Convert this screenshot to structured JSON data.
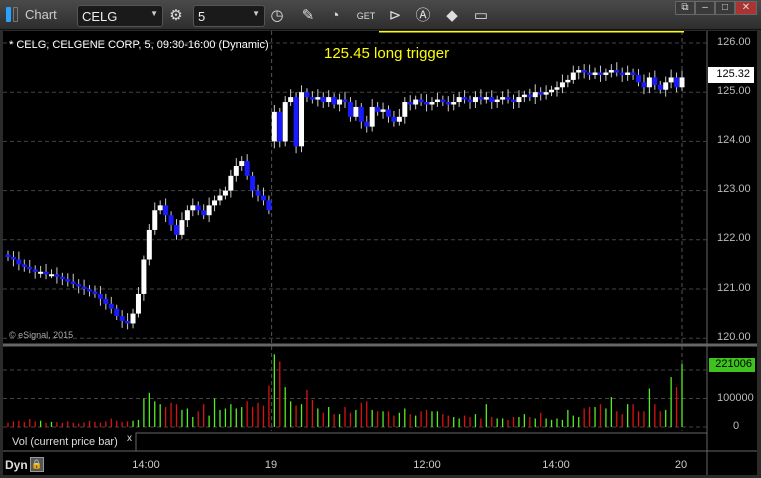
{
  "window": {
    "title": "Chart",
    "symbol": "CELG",
    "interval": "5"
  },
  "toolbar": {
    "icons": [
      "settings-icon",
      "clock-icon",
      "pencil-icon",
      "study-icon",
      "get-icon",
      "play-icon",
      "alert-icon",
      "eraser-icon",
      "comment-icon"
    ]
  },
  "chart": {
    "header": "* CELG, CELGENE CORP, 5, 09:30-16:00 (Dynamic)",
    "annotation": "125.45 long trigger",
    "trigger_price": 125.32,
    "copyright": "© eSignal, 2015",
    "last_price": "125.32",
    "last_volume": "221006",
    "price_labels": [
      "126.00",
      "125.00",
      "124.00",
      "123.00",
      "122.00",
      "121.00",
      "120.00"
    ],
    "volume_labels": [
      "100000",
      "0"
    ],
    "time_labels": [
      "14:00",
      "19",
      "12:00",
      "14:00",
      "20"
    ],
    "volume_study": "Vol (current price bar)",
    "volume_close": "x",
    "dyn_label": "Dyn",
    "colors": {
      "up": "#ffffff",
      "down": "#1a1aff",
      "vol_up": "#55ee22",
      "vol_down": "#dd1111",
      "trigger": "#ffff00"
    }
  },
  "chart_data": {
    "type": "candlestick",
    "ylim": [
      120,
      126.2
    ],
    "closes": [
      121.65,
      121.6,
      121.5,
      121.45,
      121.4,
      121.35,
      121.35,
      121.3,
      121.3,
      121.25,
      121.2,
      121.15,
      121.1,
      121.05,
      121.0,
      120.95,
      120.9,
      120.8,
      120.7,
      120.6,
      120.45,
      120.35,
      120.3,
      120.5,
      120.9,
      121.6,
      122.2,
      122.6,
      122.7,
      122.5,
      122.3,
      122.1,
      122.4,
      122.6,
      122.7,
      122.6,
      122.5,
      122.7,
      122.8,
      122.9,
      123.0,
      123.3,
      123.5,
      123.6,
      123.3,
      123.0,
      122.9,
      122.8,
      122.6,
      124.6,
      124.0,
      124.8,
      124.9,
      123.9,
      125.0,
      124.9,
      124.85,
      124.9,
      124.8,
      124.9,
      124.75,
      124.85,
      124.8,
      124.5,
      124.7,
      124.4,
      124.3,
      124.7,
      124.6,
      124.65,
      124.5,
      124.4,
      124.5,
      124.8,
      124.75,
      124.85,
      124.8,
      124.75,
      124.8,
      124.85,
      124.8,
      124.75,
      124.8,
      124.9,
      124.85,
      124.8,
      124.9,
      124.85,
      124.9,
      124.8,
      124.85,
      124.9,
      124.85,
      124.8,
      124.9,
      124.95,
      124.9,
      125.0,
      124.95,
      125.0,
      125.05,
      125.1,
      125.2,
      125.25,
      125.4,
      125.45,
      125.4,
      125.35,
      125.4,
      125.35,
      125.4,
      125.45,
      125.4,
      125.35,
      125.4,
      125.35,
      125.2,
      125.1,
      125.3,
      125.15,
      125.05,
      125.2,
      125.3,
      125.1,
      125.3
    ],
    "volumes": [
      15,
      20,
      22,
      18,
      28,
      20,
      22,
      15,
      18,
      17,
      14,
      20,
      15,
      12,
      16,
      22,
      18,
      15,
      20,
      30,
      22,
      18,
      20,
      22,
      25,
      100,
      120,
      90,
      80,
      70,
      85,
      80,
      60,
      65,
      35,
      55,
      80,
      40,
      100,
      60,
      65,
      80,
      65,
      70,
      90,
      70,
      85,
      75,
      145,
      255,
      230,
      140,
      90,
      75,
      80,
      130,
      95,
      65,
      50,
      70,
      45,
      45,
      70,
      50,
      60,
      85,
      90,
      60,
      55,
      55,
      55,
      40,
      50,
      65,
      45,
      40,
      55,
      60,
      55,
      55,
      45,
      40,
      35,
      30,
      40,
      35,
      45,
      30,
      80,
      35,
      30,
      30,
      25,
      35,
      35,
      45,
      35,
      30,
      50,
      30,
      25,
      30,
      25,
      60,
      40,
      35,
      65,
      70,
      70,
      80,
      65,
      105,
      55,
      45,
      80,
      80,
      55,
      55,
      135,
      80,
      55,
      60,
      175,
      140,
      221
    ],
    "day_break_index": 49
  }
}
